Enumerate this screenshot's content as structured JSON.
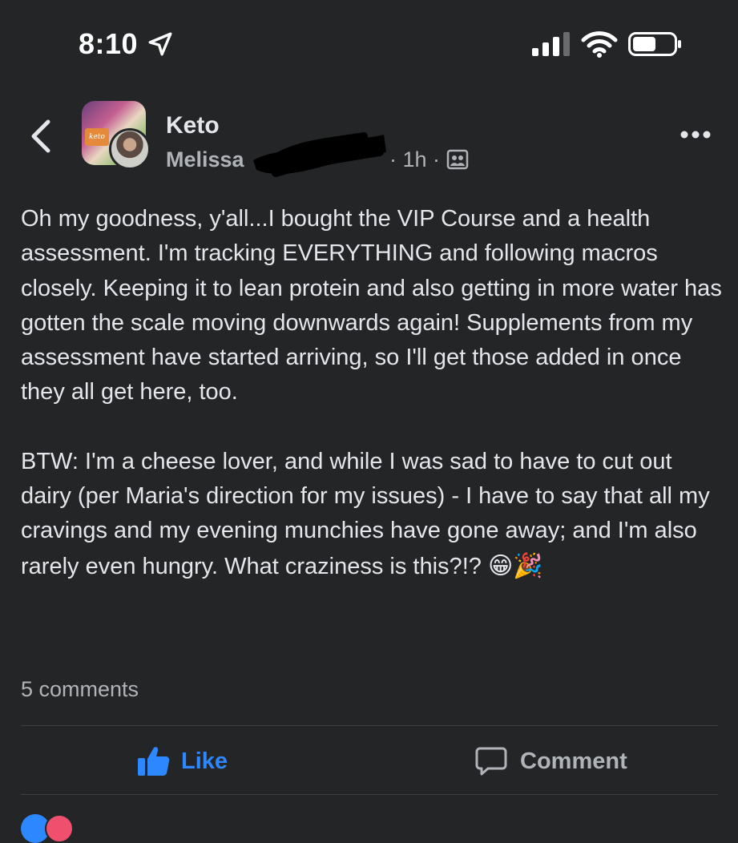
{
  "status_bar": {
    "time": "8:10",
    "icons": [
      "location-arrow-icon",
      "signal-bars-icon",
      "wifi-icon",
      "battery-icon"
    ]
  },
  "header": {
    "group_name": "Keto",
    "author_name": "Melissa",
    "timestamp": "· 1h ·",
    "avatar_tag": "keto"
  },
  "post": {
    "paragraph1": "Oh my goodness, y'all...I bought the VIP Course and a health assessment. I'm tracking EVERYTHING and following macros closely. Keeping it to lean protein and also getting in more water has gotten the scale moving downwards again! Supplements from my assessment have started arriving, so I'll get those added in once they all get here, too.",
    "paragraph2": "BTW: I'm a cheese lover, and while I was sad to have to cut out dairy (per Maria's direction for my issues) - I have to say that all my cravings and my evening munchies have gone away; and I'm also rarely even hungry. What craziness is this?!?",
    "emojis": "😁🎉"
  },
  "footer": {
    "comments_count": "5 comments",
    "like_label": "Like",
    "comment_label": "Comment"
  },
  "colors": {
    "background": "#242526",
    "text": "#e4e6eb",
    "secondary": "#b0b3b8",
    "accent": "#2d88ff"
  }
}
